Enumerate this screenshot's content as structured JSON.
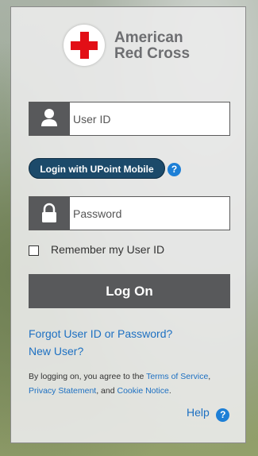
{
  "brand": {
    "name_line1": "American",
    "name_line2": "Red Cross"
  },
  "login": {
    "userid_placeholder": "User ID",
    "password_placeholder": "Password",
    "upoint_button": "Login with UPoint Mobile",
    "help_mark": "?",
    "remember_label": "Remember my User ID",
    "remember_checked": false,
    "logon_button": "Log On"
  },
  "links": {
    "forgot": "Forgot User ID or Password?",
    "new_user": "New User?",
    "help": "Help"
  },
  "terms": {
    "prefix": "By logging on, you agree to the",
    "tos": "Terms of Service",
    "comma": ",",
    "privacy": "Privacy Statement",
    "and": ", and",
    "cookie": "Cookie Notice",
    "end": "."
  },
  "colors": {
    "brand_red": "#e20f16",
    "link_blue": "#1d70c2",
    "button_gray": "#58595b",
    "upoint_navy": "#1c4a6a"
  },
  "icons": [
    "person-icon",
    "lock-icon",
    "help-question-icon",
    "red-cross-logo"
  ]
}
